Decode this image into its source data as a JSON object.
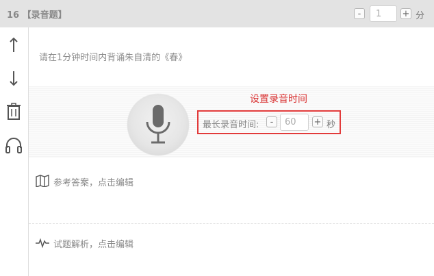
{
  "header": {
    "question_title": "16 【录音题】",
    "score": {
      "decrement_label": "-",
      "value": "1",
      "increment_label": "+",
      "unit": "分"
    }
  },
  "sidebar": {
    "items": [
      {
        "icon": "arrow-up-icon"
      },
      {
        "icon": "arrow-down-icon"
      },
      {
        "icon": "trash-icon"
      },
      {
        "icon": "headphones-icon"
      }
    ]
  },
  "question": {
    "prompt": "请在1分钟时间内背诵朱自清的《春》"
  },
  "recording": {
    "mic_icon": "microphone-icon",
    "annotation_label": "设置录音时间",
    "annotation_color": "#e23b3b",
    "max_duration_label": "最长录音时间:",
    "decrement_label": "-",
    "duration_value": "60",
    "increment_label": "+",
    "unit": "秒"
  },
  "answer": {
    "icon": "map-icon",
    "label": "参考答案，点击编辑"
  },
  "analysis": {
    "icon": "pulse-icon",
    "label": "试题解析，点击编辑"
  }
}
